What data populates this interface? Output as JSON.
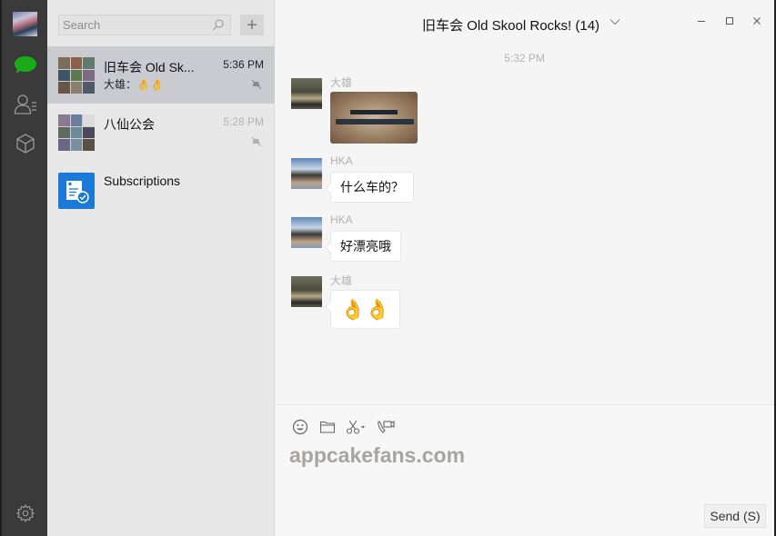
{
  "nav": {
    "items": [
      {
        "name": "chats",
        "icon": "chat-bubble-icon",
        "active": true
      },
      {
        "name": "contacts",
        "icon": "contacts-icon",
        "active": false
      },
      {
        "name": "favorites",
        "icon": "cube-icon",
        "active": false
      }
    ],
    "settings_icon": "gear-icon",
    "accent_color": "#1aad19"
  },
  "sidebar": {
    "search": {
      "placeholder": "Search",
      "value": ""
    },
    "add_label": "+",
    "conversations": [
      {
        "name": "旧车会 Old  Sk...",
        "preview": "大雄：",
        "preview_emoji": "👌👌",
        "time": "5:36 PM",
        "muted": true,
        "active": true
      },
      {
        "name": "八仙公会",
        "preview": "",
        "time": "5:28 PM",
        "muted": true,
        "active": false
      },
      {
        "name": "Subscriptions",
        "preview": "",
        "time": "",
        "muted": false,
        "active": false
      }
    ]
  },
  "chat": {
    "title": "旧车会 Old  Skool  Rocks! (14)",
    "window_controls": {
      "minimize": "–",
      "maximize": "□",
      "close": "×"
    },
    "timestamp": "5:32 PM",
    "messages": [
      {
        "sender": "大雄",
        "type": "image",
        "content": "license plate photo"
      },
      {
        "sender": "HKA",
        "type": "text",
        "content": "什么车的？"
      },
      {
        "sender": "HKA",
        "type": "text",
        "content": "好漂亮哦"
      },
      {
        "sender": "大雄",
        "type": "emoji",
        "content": "👌👌"
      }
    ]
  },
  "composer": {
    "tools": [
      "emoji-icon",
      "folder-icon",
      "scissors-icon",
      "video-call-icon"
    ],
    "value": "appcakefans.com",
    "send_label": "Send (S)"
  }
}
